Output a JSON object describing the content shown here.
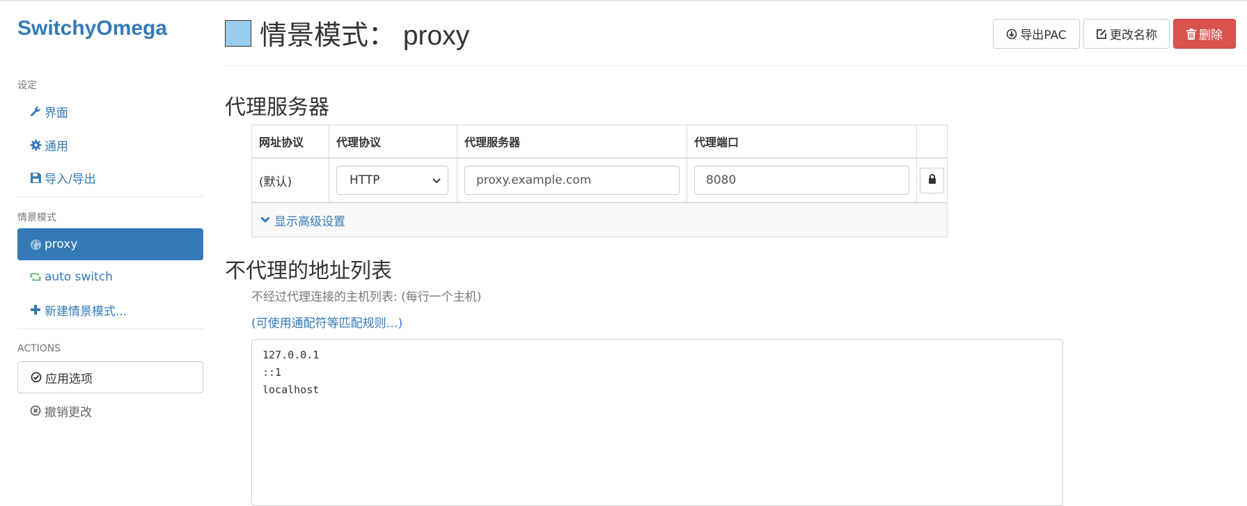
{
  "app": {
    "brand": "SwitchyOmega"
  },
  "sidebar": {
    "settings_header": "设定",
    "settings_items": [
      {
        "label": "界面",
        "icon": "wrench-icon"
      },
      {
        "label": "通用",
        "icon": "gear-icon"
      },
      {
        "label": "导入/导出",
        "icon": "save-icon"
      }
    ],
    "profiles_header": "情景模式",
    "profile_items": [
      {
        "label": "proxy",
        "icon": "globe-icon",
        "active": true
      },
      {
        "label": "auto switch",
        "icon": "retweet-icon"
      },
      {
        "label": "新建情景模式...",
        "icon": "plus-icon"
      }
    ],
    "actions_header": "ACTIONS",
    "actions": [
      {
        "label": "应用选项",
        "icon": "check-circle-icon"
      },
      {
        "label": "撤销更改",
        "icon": "x-circle-icon"
      }
    ]
  },
  "header": {
    "title": "情景模式： proxy",
    "swatch_color": "#99ccee",
    "buttons": {
      "export_pac": "导出PAC",
      "rename": "更改名称",
      "delete": "删除"
    }
  },
  "proxy_section": {
    "title": "代理服务器",
    "columns": [
      "网址协议",
      "代理协议",
      "代理服务器",
      "代理端口"
    ],
    "row": {
      "scheme": "(默认)",
      "protocol": "HTTP",
      "server": "proxy.example.com",
      "port": "8080"
    },
    "advanced_link": "显示高级设置"
  },
  "bypass_section": {
    "title": "不代理的地址列表",
    "help_text": "不经过代理连接的主机列表: (每行一个主机)",
    "help_link": "(可使用通配符等匹配规则…)",
    "list": "127.0.0.1\n::1\nlocalhost"
  },
  "colors": {
    "accent": "#337ab7",
    "danger": "#d9534f",
    "green": "#5cb85c"
  }
}
